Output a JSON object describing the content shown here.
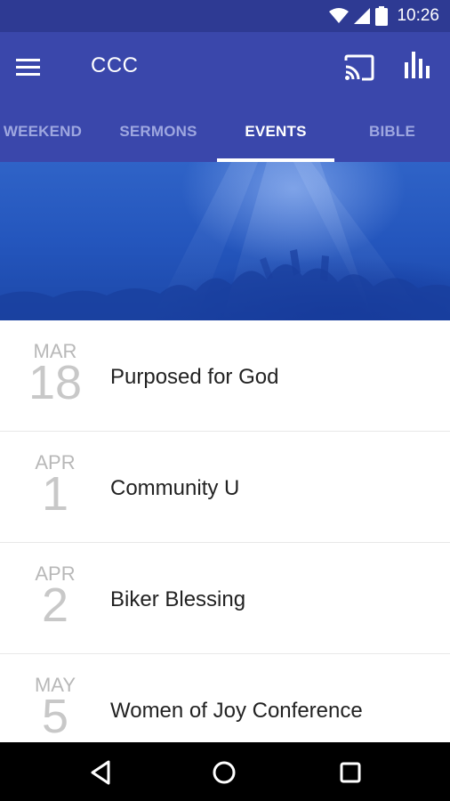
{
  "status": {
    "time": "10:26"
  },
  "app": {
    "title": "CCC"
  },
  "tabs": [
    {
      "label": "WEEKEND"
    },
    {
      "label": "SERMONS"
    },
    {
      "label": "EVENTS"
    },
    {
      "label": "BIBLE"
    }
  ],
  "events": [
    {
      "month": "MAR",
      "day": "18",
      "title": "Purposed for God"
    },
    {
      "month": "APR",
      "day": "1",
      "title": "Community U"
    },
    {
      "month": "APR",
      "day": "2",
      "title": "Biker Blessing"
    },
    {
      "month": "MAY",
      "day": "5",
      "title": "Women of Joy Conference"
    }
  ],
  "colors": {
    "status_bar": "#2e3a93",
    "app_bar": "#3a47ab",
    "tab_inactive": "#9ea7e0",
    "tab_active": "#ffffff"
  },
  "icons": {
    "wifi": "wifi-icon",
    "signal": "signal-icon",
    "battery": "battery-icon",
    "menu": "menu-icon",
    "cast": "cast-icon",
    "stats": "bar-chart-icon",
    "back": "back-icon",
    "home": "home-icon",
    "recents": "recents-icon"
  }
}
